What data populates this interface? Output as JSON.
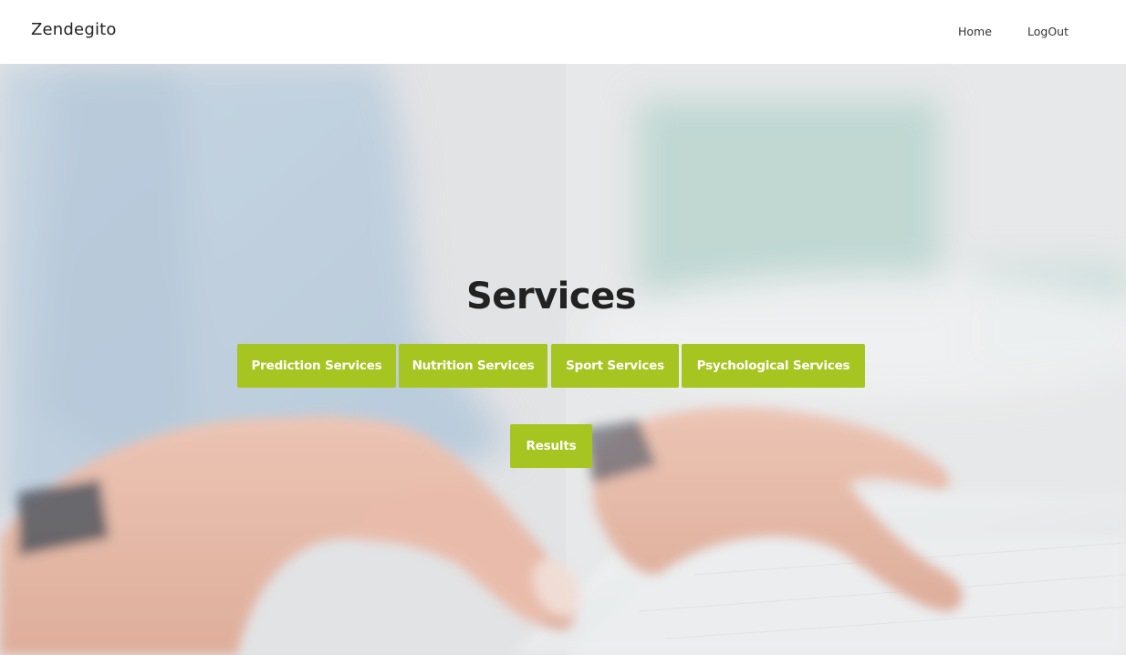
{
  "navbar": {
    "brand": "Zendegito",
    "links": [
      {
        "label": "Home"
      },
      {
        "label": "LogOut"
      }
    ]
  },
  "hero": {
    "title": "Services",
    "buttons": [
      {
        "label": "Prediction Services"
      },
      {
        "label": "Nutrition Services"
      },
      {
        "label": "Sport Services"
      },
      {
        "label": "Psychological Services"
      }
    ],
    "results_button": "Results"
  },
  "colors": {
    "accent": "#a6c520",
    "navbar_bg": "#ffffff",
    "title_text": "#222222",
    "button_text": "#ffffff"
  }
}
